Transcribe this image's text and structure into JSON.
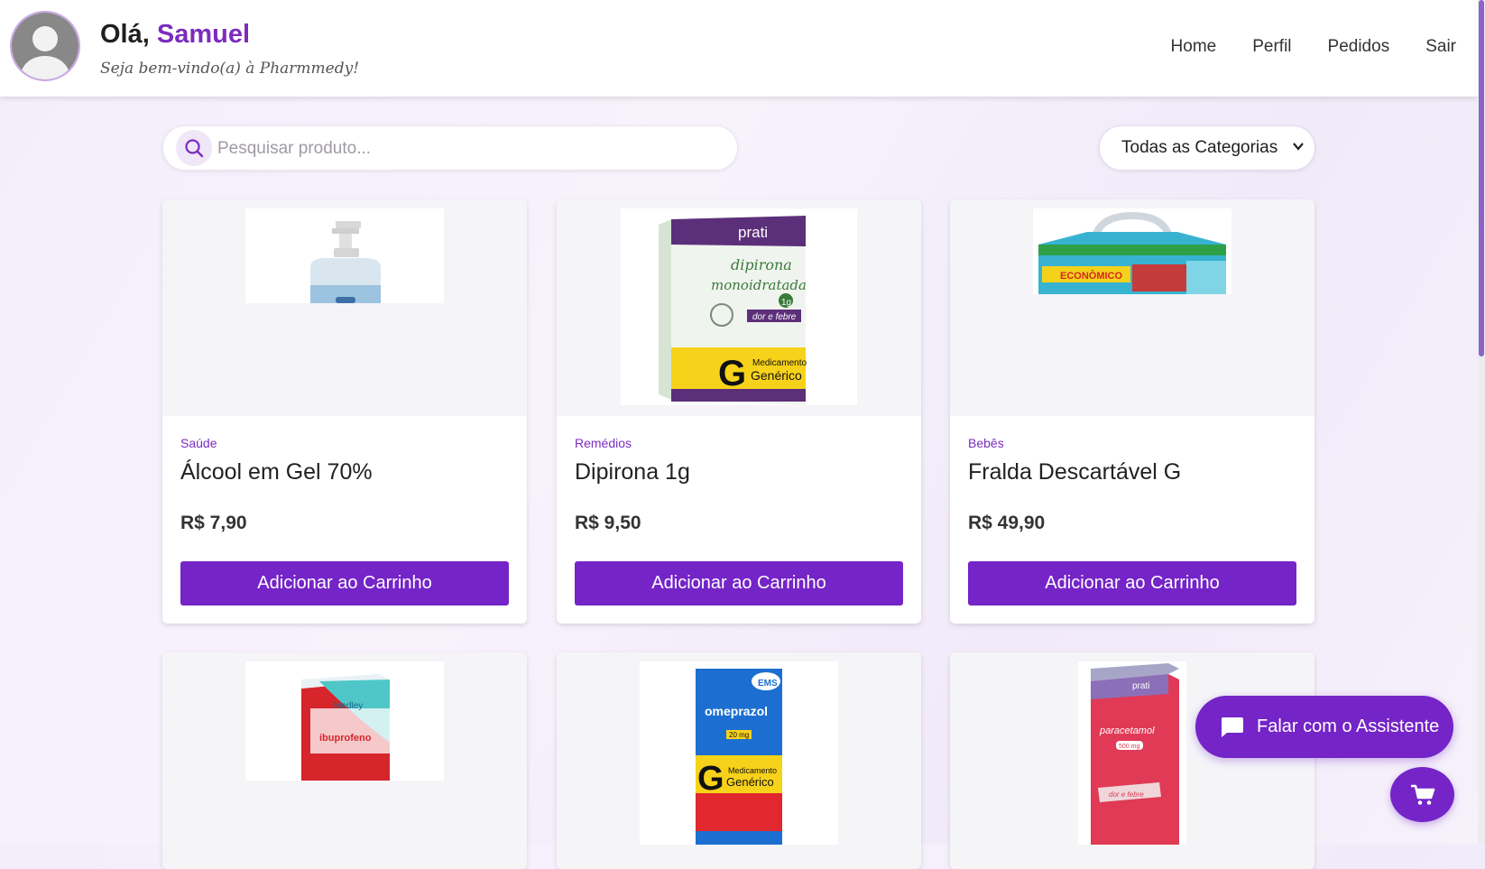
{
  "header": {
    "greeting": "Olá,",
    "user_name": "Samuel",
    "welcome": "Seja bem-vindo(a) à Pharmmedy!",
    "nav": [
      "Home",
      "Perfil",
      "Pedidos",
      "Sair"
    ]
  },
  "search": {
    "placeholder": "Pesquisar produto..."
  },
  "category_filter": {
    "selected": "Todas as Categorias"
  },
  "products": [
    {
      "category": "Saúde",
      "name": "Álcool em Gel 70%",
      "price": "R$ 7,90",
      "button": "Adicionar ao Carrinho"
    },
    {
      "category": "Remédios",
      "name": "Dipirona 1g",
      "price": "R$ 9,50",
      "button": "Adicionar ao Carrinho"
    },
    {
      "category": "Bebês",
      "name": "Fralda Descartável G",
      "price": "R$ 49,90",
      "button": "Adicionar ao Carrinho"
    },
    {
      "category": "",
      "name": "",
      "price": "",
      "button": ""
    },
    {
      "category": "",
      "name": "",
      "price": "",
      "button": ""
    },
    {
      "category": "",
      "name": "",
      "price": "",
      "button": ""
    }
  ],
  "product_images": {
    "dipirona": [
      "prati",
      "dipirona",
      "monoidratada",
      "1g",
      "dor e febre",
      "Medicamento",
      "Genérico"
    ],
    "fralda": "ECONÔMICO",
    "ibuprofeno": [
      "Medley",
      "ibuprofeno"
    ],
    "omeprazol": [
      "EMS",
      "omeprazol",
      "20 mg",
      "Medicamento",
      "Genérico"
    ],
    "paracetamol": [
      "prati",
      "paracetamol",
      "500 mg",
      "dor e febre"
    ]
  },
  "assistant_button": {
    "label": "Falar com o Assistente"
  },
  "icons": {
    "search": "search-icon",
    "chat": "chat-icon",
    "cart": "cart-icon",
    "chevron": "chevron-down-icon"
  },
  "colors": {
    "accent": "#7424c7",
    "accent_text": "#7b2cbf"
  }
}
